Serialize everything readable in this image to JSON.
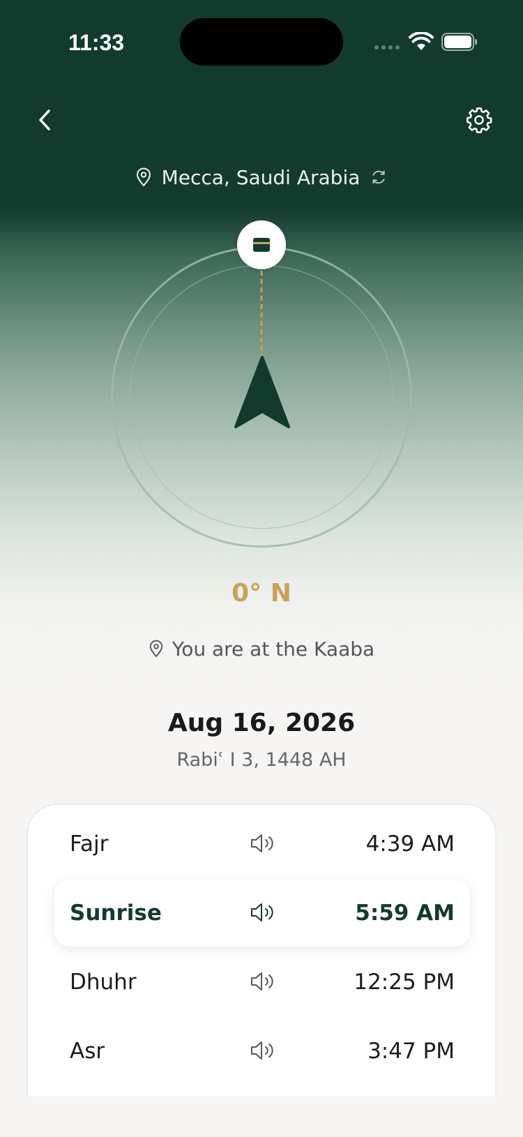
{
  "status_bar": {
    "time": "11:33"
  },
  "header": {
    "location": "Mecca, Saudi Arabia"
  },
  "compass": {
    "heading": "0° N",
    "status": "You are at the Kaaba"
  },
  "date": {
    "gregorian": "Aug 16, 2026",
    "hijri": "Rabiʿ I 3, 1448 AH"
  },
  "prayers": [
    {
      "name": "Fajr",
      "time": "4:39 AM",
      "active": false
    },
    {
      "name": "Sunrise",
      "time": "5:59 AM",
      "active": true
    },
    {
      "name": "Dhuhr",
      "time": "12:25 PM",
      "active": false
    },
    {
      "name": "Asr",
      "time": "3:47 PM",
      "active": false
    }
  ],
  "colors": {
    "primary": "#123b2e",
    "accent": "#c9a15a",
    "background": "#f6f5f3"
  },
  "icons": [
    "back-chevron-icon",
    "gear-icon",
    "location-pin-icon",
    "refresh-icon",
    "kaaba-icon",
    "qibla-arrow-icon",
    "speaker-icon"
  ]
}
